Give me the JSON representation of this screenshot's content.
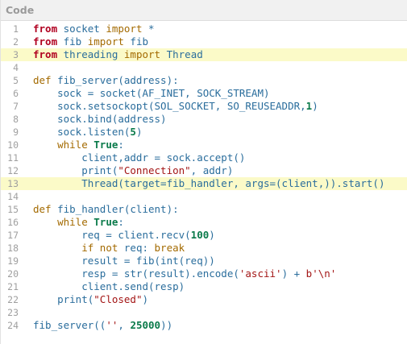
{
  "header": {
    "title": "Code"
  },
  "editor": {
    "highlighted_lines": [
      3,
      13
    ],
    "lines": [
      {
        "n": "1",
        "t": [
          [
            "kw",
            "from"
          ],
          [
            "pl",
            " socket "
          ],
          [
            "kw2",
            "import"
          ],
          [
            "pl",
            " *"
          ]
        ]
      },
      {
        "n": "2",
        "t": [
          [
            "kw",
            "from"
          ],
          [
            "pl",
            " fib "
          ],
          [
            "kw2",
            "import"
          ],
          [
            "pl",
            " fib"
          ]
        ]
      },
      {
        "n": "3",
        "t": [
          [
            "kw",
            "from"
          ],
          [
            "pl",
            " threading "
          ],
          [
            "kw2",
            "import"
          ],
          [
            "pl",
            " Thread"
          ]
        ]
      },
      {
        "n": "4",
        "t": []
      },
      {
        "n": "5",
        "t": [
          [
            "kw2",
            "def"
          ],
          [
            "pl",
            " fib_server(address):"
          ]
        ]
      },
      {
        "n": "6",
        "t": [
          [
            "pl",
            "    sock = socket(AF_INET, SOCK_STREAM)"
          ]
        ]
      },
      {
        "n": "7",
        "t": [
          [
            "pl",
            "    sock.setsockopt(SOL_SOCKET, SO_REUSEADDR,"
          ],
          [
            "num",
            "1"
          ],
          [
            "pl",
            ")"
          ]
        ]
      },
      {
        "n": "8",
        "t": [
          [
            "pl",
            "    sock.bind(address)"
          ]
        ]
      },
      {
        "n": "9",
        "t": [
          [
            "pl",
            "    sock.listen("
          ],
          [
            "num",
            "5"
          ],
          [
            "pl",
            ")"
          ]
        ]
      },
      {
        "n": "10",
        "t": [
          [
            "pl",
            "    "
          ],
          [
            "kw2",
            "while"
          ],
          [
            "pl",
            " "
          ],
          [
            "num",
            "True"
          ],
          [
            "pl",
            ":"
          ]
        ]
      },
      {
        "n": "11",
        "t": [
          [
            "pl",
            "        client,addr = sock.accept()"
          ]
        ]
      },
      {
        "n": "12",
        "t": [
          [
            "pl",
            "        print("
          ],
          [
            "str",
            "\"Connection\""
          ],
          [
            "pl",
            ", addr)"
          ]
        ]
      },
      {
        "n": "13",
        "t": [
          [
            "pl",
            "        Thread(target=fib_handler, args=(client,)).start()"
          ]
        ]
      },
      {
        "n": "14",
        "t": []
      },
      {
        "n": "15",
        "t": [
          [
            "kw2",
            "def"
          ],
          [
            "pl",
            " fib_handler(client):"
          ]
        ]
      },
      {
        "n": "16",
        "t": [
          [
            "pl",
            "    "
          ],
          [
            "kw2",
            "while"
          ],
          [
            "pl",
            " "
          ],
          [
            "num",
            "True"
          ],
          [
            "pl",
            ":"
          ]
        ]
      },
      {
        "n": "17",
        "t": [
          [
            "pl",
            "        req = client.recv("
          ],
          [
            "num",
            "100"
          ],
          [
            "pl",
            ")"
          ]
        ]
      },
      {
        "n": "18",
        "t": [
          [
            "pl",
            "        "
          ],
          [
            "kw2",
            "if not"
          ],
          [
            "pl",
            " req: "
          ],
          [
            "kw2",
            "break"
          ]
        ]
      },
      {
        "n": "19",
        "t": [
          [
            "pl",
            "        result = fib(int(req))"
          ]
        ]
      },
      {
        "n": "20",
        "t": [
          [
            "pl",
            "        resp = str(result).encode("
          ],
          [
            "str",
            "'ascii'"
          ],
          [
            "pl",
            ") + "
          ],
          [
            "str",
            "b'\\n'"
          ]
        ]
      },
      {
        "n": "21",
        "t": [
          [
            "pl",
            "        client.send(resp)"
          ]
        ]
      },
      {
        "n": "22",
        "t": [
          [
            "pl",
            "    print("
          ],
          [
            "str",
            "\"Closed\""
          ],
          [
            "pl",
            ")"
          ]
        ]
      },
      {
        "n": "23",
        "t": []
      },
      {
        "n": "24",
        "t": [
          [
            "pl",
            "fib_server(("
          ],
          [
            "str",
            "''"
          ],
          [
            "pl",
            ", "
          ],
          [
            "num",
            "25000"
          ],
          [
            "pl",
            "))"
          ]
        ]
      }
    ]
  }
}
